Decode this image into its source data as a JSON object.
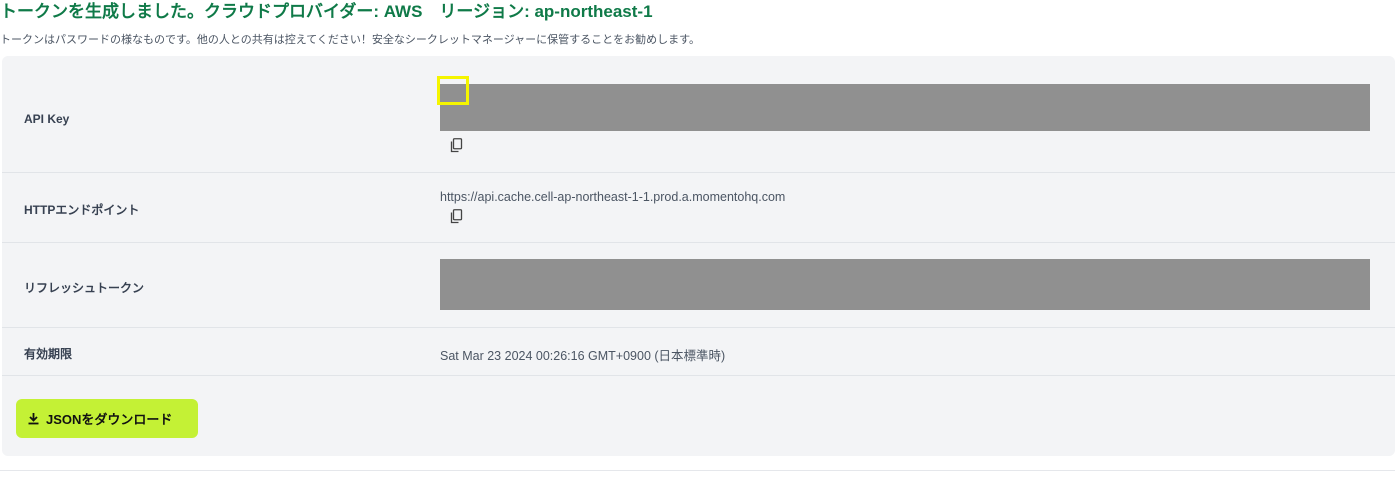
{
  "header": {
    "title": "トークンを生成しました。クラウドプロバイダー: AWS　リージョン: ap-northeast-1",
    "subtitle": "トークンはパスワードの様なものです。他の人との共有は控えてください！安全なシークレットマネージャーに保管することをお勧めします。"
  },
  "rows": {
    "api_key": {
      "label": "API Key",
      "value_redacted": true
    },
    "http_endpoint": {
      "label": "HTTPエンドポイント",
      "value": "https://api.cache.cell-ap-northeast-1-1.prod.a.momentohq.com"
    },
    "refresh_token": {
      "label": "リフレッシュトークン",
      "value_redacted": true
    },
    "expiry": {
      "label": "有効期限",
      "value": "Sat Mar 23 2024 00:26:16 GMT+0900 (日本標準時)"
    }
  },
  "actions": {
    "download_json_label": "JSONをダウンロード"
  },
  "icons": {
    "copy": "copy-icon",
    "download": "download-icon"
  },
  "colors": {
    "title": "#0f7a48",
    "download_button": "#c4f135",
    "redaction": "#909090",
    "highlight": "#f5f500"
  }
}
